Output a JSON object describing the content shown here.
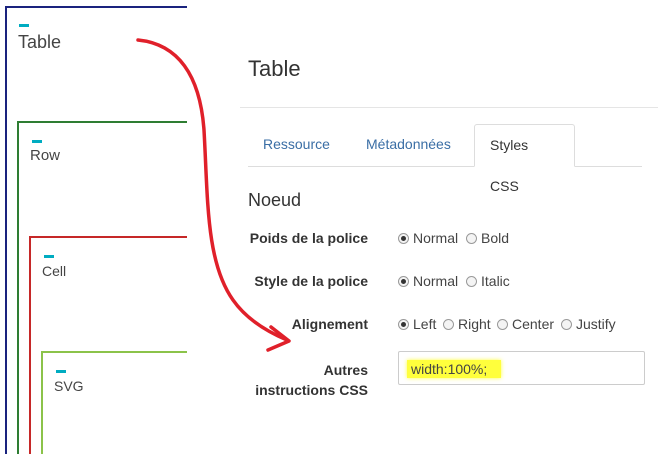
{
  "diagram": {
    "boxes": [
      {
        "label": "Table"
      },
      {
        "label": "Row"
      },
      {
        "label": "Cell"
      },
      {
        "label": "SVG"
      }
    ]
  },
  "panel": {
    "title": "Table",
    "tabs": [
      {
        "label": "Ressource",
        "active": false
      },
      {
        "label": "Métadonnées",
        "active": false
      },
      {
        "label": "Styles CSS",
        "active": true
      }
    ],
    "section_title": "Noeud",
    "fields": {
      "font_weight": {
        "label": "Poids de la police",
        "options": [
          "Normal",
          "Bold"
        ],
        "selected": "Normal"
      },
      "font_style": {
        "label": "Style de la police",
        "options": [
          "Normal",
          "Italic"
        ],
        "selected": "Normal"
      },
      "alignment": {
        "label": "Alignement",
        "options": [
          "Left",
          "Right",
          "Center",
          "Justify"
        ],
        "selected": "Left"
      },
      "other_css": {
        "label_line1": "Autres",
        "label_line2": "instructions CSS",
        "value": "width:100%;"
      }
    }
  },
  "colors": {
    "table_border": "#1a237e",
    "row_border": "#2e7d32",
    "cell_border": "#c62828",
    "svg_border": "#8bc34a",
    "tick": "#00acc1",
    "arrow": "#e0202a",
    "highlight": "#ffff3c",
    "tab_link": "#3a6ea5"
  }
}
